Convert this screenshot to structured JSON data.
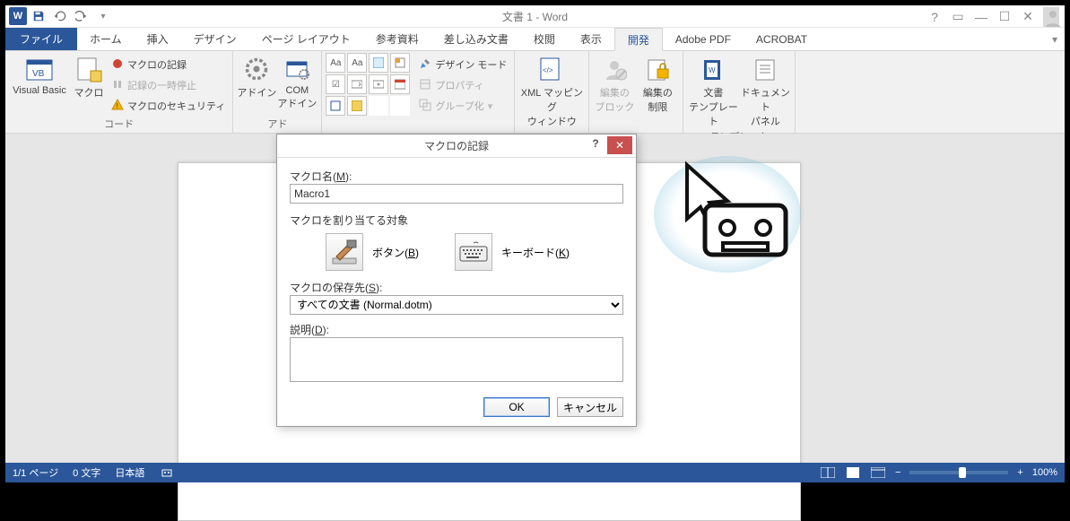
{
  "titlebar": {
    "doc": "文書 1 - Word"
  },
  "tabs": {
    "file": "ファイル",
    "items": [
      "ホーム",
      "挿入",
      "デザイン",
      "ページ レイアウト",
      "参考資料",
      "差し込み文書",
      "校閲",
      "表示",
      "開発",
      "Adobe PDF",
      "ACROBAT"
    ],
    "active_index": 8
  },
  "ribbon": {
    "group_code": "コード",
    "visual_basic": "Visual Basic",
    "macro": "マクロ",
    "rec_macro": "マクロの記録",
    "pause_rec": "記録の一時停止",
    "macro_security": "マクロのセキュリティ",
    "group_addin": "アド",
    "addin": "アドイン",
    "com_addin": "COM\nアドイン",
    "design_mode": "デザイン モード",
    "properties": "プロパティ",
    "group_ka": "グループ化",
    "xml_mapping": "XML マッピング\nウィンドウ",
    "edit_block": "編集の\nブロック",
    "edit_restrict": "編集の\n制限",
    "doc_template": "文書\nテンプレート",
    "doc_panel": "ドキュメント\nパネル",
    "group_template": "テンプレート"
  },
  "dialog": {
    "title": "マクロの記録",
    "name_label": "マクロ名(M):",
    "name_value": "Macro1",
    "assign_label": "マクロを割り当てる対象",
    "button_label": "ボタン(B)",
    "keyboard_label": "キーボード(K)",
    "save_label": "マクロの保存先(S):",
    "save_value": "すべての文書 (Normal.dotm)",
    "desc_label": "説明(D):",
    "desc_value": "",
    "ok": "OK",
    "cancel": "キャンセル"
  },
  "status": {
    "page": "1/1 ページ",
    "words": "0 文字",
    "lang": "日本語",
    "zoom": "100%"
  }
}
